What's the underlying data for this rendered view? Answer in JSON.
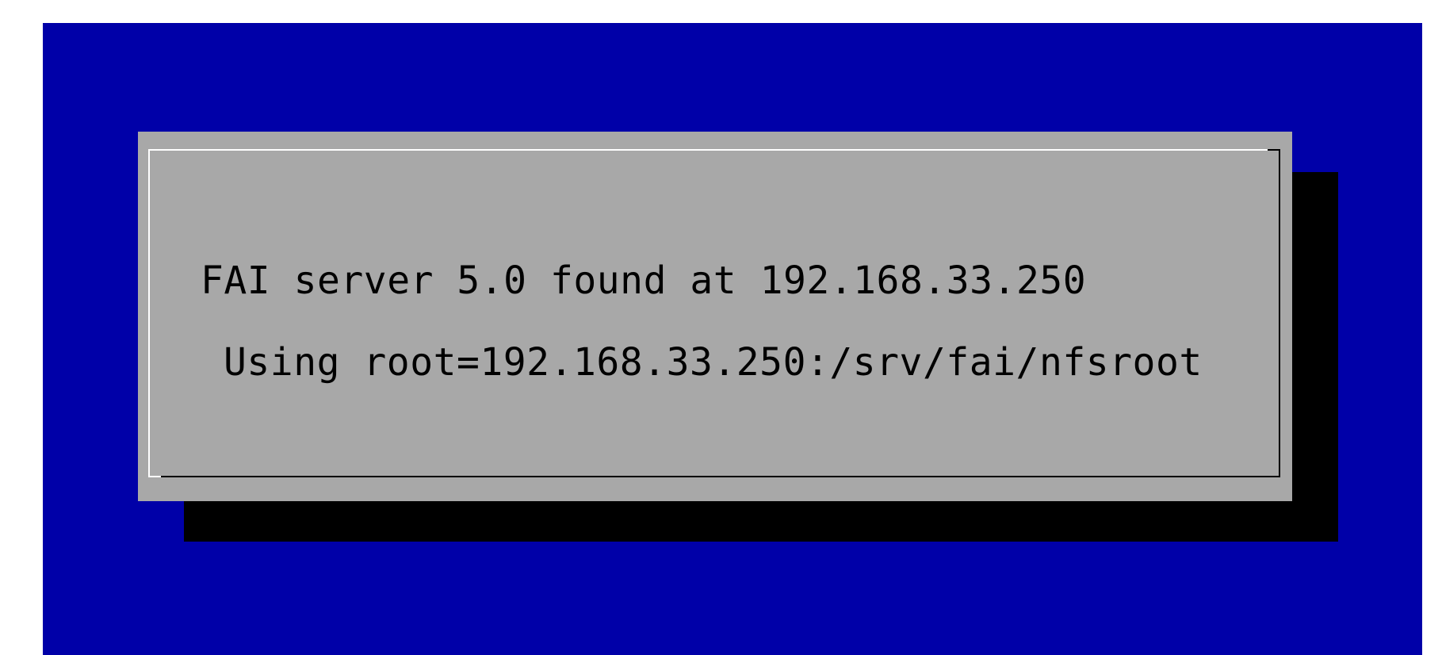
{
  "colors": {
    "screen_background": "#0000a8",
    "dialog_background": "#a8a8a8",
    "shadow": "#000000",
    "text": "#000000",
    "frame_light": "#ffffff",
    "frame_dark": "#000000"
  },
  "dialog": {
    "line1": "FAI server 5.0 found at 192.168.33.250",
    "line2": "Using root=192.168.33.250:/srv/fai/nfsroot"
  }
}
